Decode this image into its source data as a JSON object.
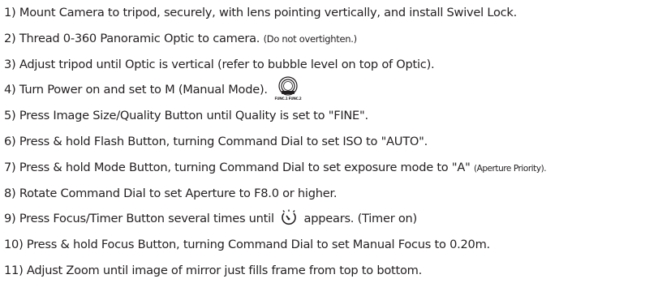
{
  "steps": [
    {
      "text": "1) Mount Camera to tripod, securely, with lens pointing vertically, and install Swivel Lock."
    },
    {
      "text": "2) Thread 0-360 Panoramic Optic to camera.",
      "note": "(Do not overtighten.)"
    },
    {
      "text": "3) Adjust tripod until Optic is vertical (refer to bubble level on top of Optic)."
    },
    {
      "text": "4) Turn Power on and set to M (Manual Mode).",
      "icon": "mode-dial-icon",
      "icon_label": "FUNC.1 FUNC.2"
    },
    {
      "text": "5) Press Image Size/Quality Button until Quality is set to \"FINE\"."
    },
    {
      "text": "6) Press & hold Flash Button, turning Command Dial to set ISO to \"AUTO\"."
    },
    {
      "text": "7) Press & hold Mode Button, turning Command Dial to set exposure mode to \"A\"",
      "note": "(Aperture Priority)."
    },
    {
      "text": "8) Rotate Command Dial to set Aperture to F8.0 or higher."
    },
    {
      "text_before": "9) Press Focus/Timer Button several times until",
      "icon": "self-timer-icon",
      "text_after": "appears. (Timer on)"
    },
    {
      "text": "10) Press & hold Focus Button, turning Command Dial to set Manual Focus to 0.20m."
    },
    {
      "text": "11) Adjust Zoom until image of mirror just fills frame from top to bottom."
    }
  ]
}
